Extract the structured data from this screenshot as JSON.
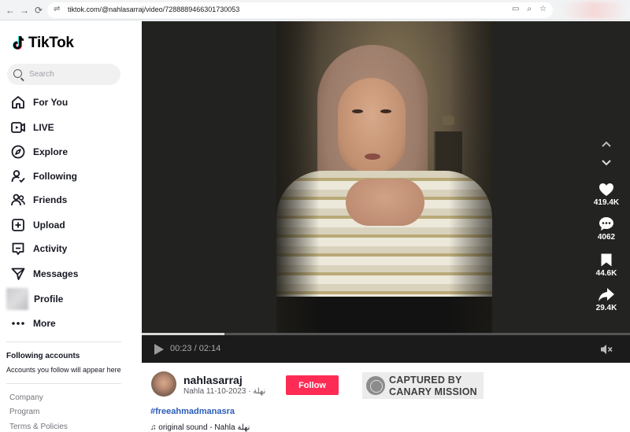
{
  "browser": {
    "url": "tiktok.com/@nahlasarraj/video/7288889466301730053",
    "back_glyph": "←",
    "forward_glyph": "→",
    "reload_glyph": "⟳",
    "site_info_glyph": "⇌",
    "tool_icons": [
      "install-app-icon",
      "zoom-icon",
      "bookmark-star-icon"
    ]
  },
  "brand": {
    "name": "TikTok",
    "accent": "#fe2c55",
    "cyan": "#25f4ee"
  },
  "search": {
    "placeholder": "Search"
  },
  "nav": [
    {
      "label": "For You",
      "icon": "home-icon"
    },
    {
      "label": "LIVE",
      "icon": "live-icon"
    },
    {
      "label": "Explore",
      "icon": "compass-icon"
    },
    {
      "label": "Following",
      "icon": "following-icon"
    },
    {
      "label": "Friends",
      "icon": "friends-icon"
    },
    {
      "label": "Upload",
      "icon": "upload-icon"
    },
    {
      "label": "Activity",
      "icon": "activity-icon"
    },
    {
      "label": "Messages",
      "icon": "messages-icon"
    },
    {
      "label": "Profile",
      "icon": "profile-avatar"
    },
    {
      "label": "More",
      "icon": "more-icon"
    }
  ],
  "following_accounts": {
    "title": "Following accounts",
    "empty_text": "Accounts you follow will appear here"
  },
  "footer_links": [
    "Company",
    "Program",
    "Terms & Policies"
  ],
  "player": {
    "current_time": "00:23",
    "duration": "02:14",
    "time_text": "00:23 / 02:14",
    "progress_fraction": 0.17,
    "muted": true
  },
  "actions": {
    "likes": "419.4K",
    "comments": "4062",
    "saves": "44.6K",
    "shares": "29.4K"
  },
  "author": {
    "username": "nahlasarraj",
    "display_line": "Nahla نهلة · 2023-10-11",
    "follow_label": "Follow"
  },
  "watermark": {
    "line1": "CAPTURED BY",
    "line2": "CANARY MISSION"
  },
  "caption": {
    "hashtag": "#freeahmadmanasra"
  },
  "sound": {
    "text": "♫ original sound - Nahla نهلة"
  }
}
